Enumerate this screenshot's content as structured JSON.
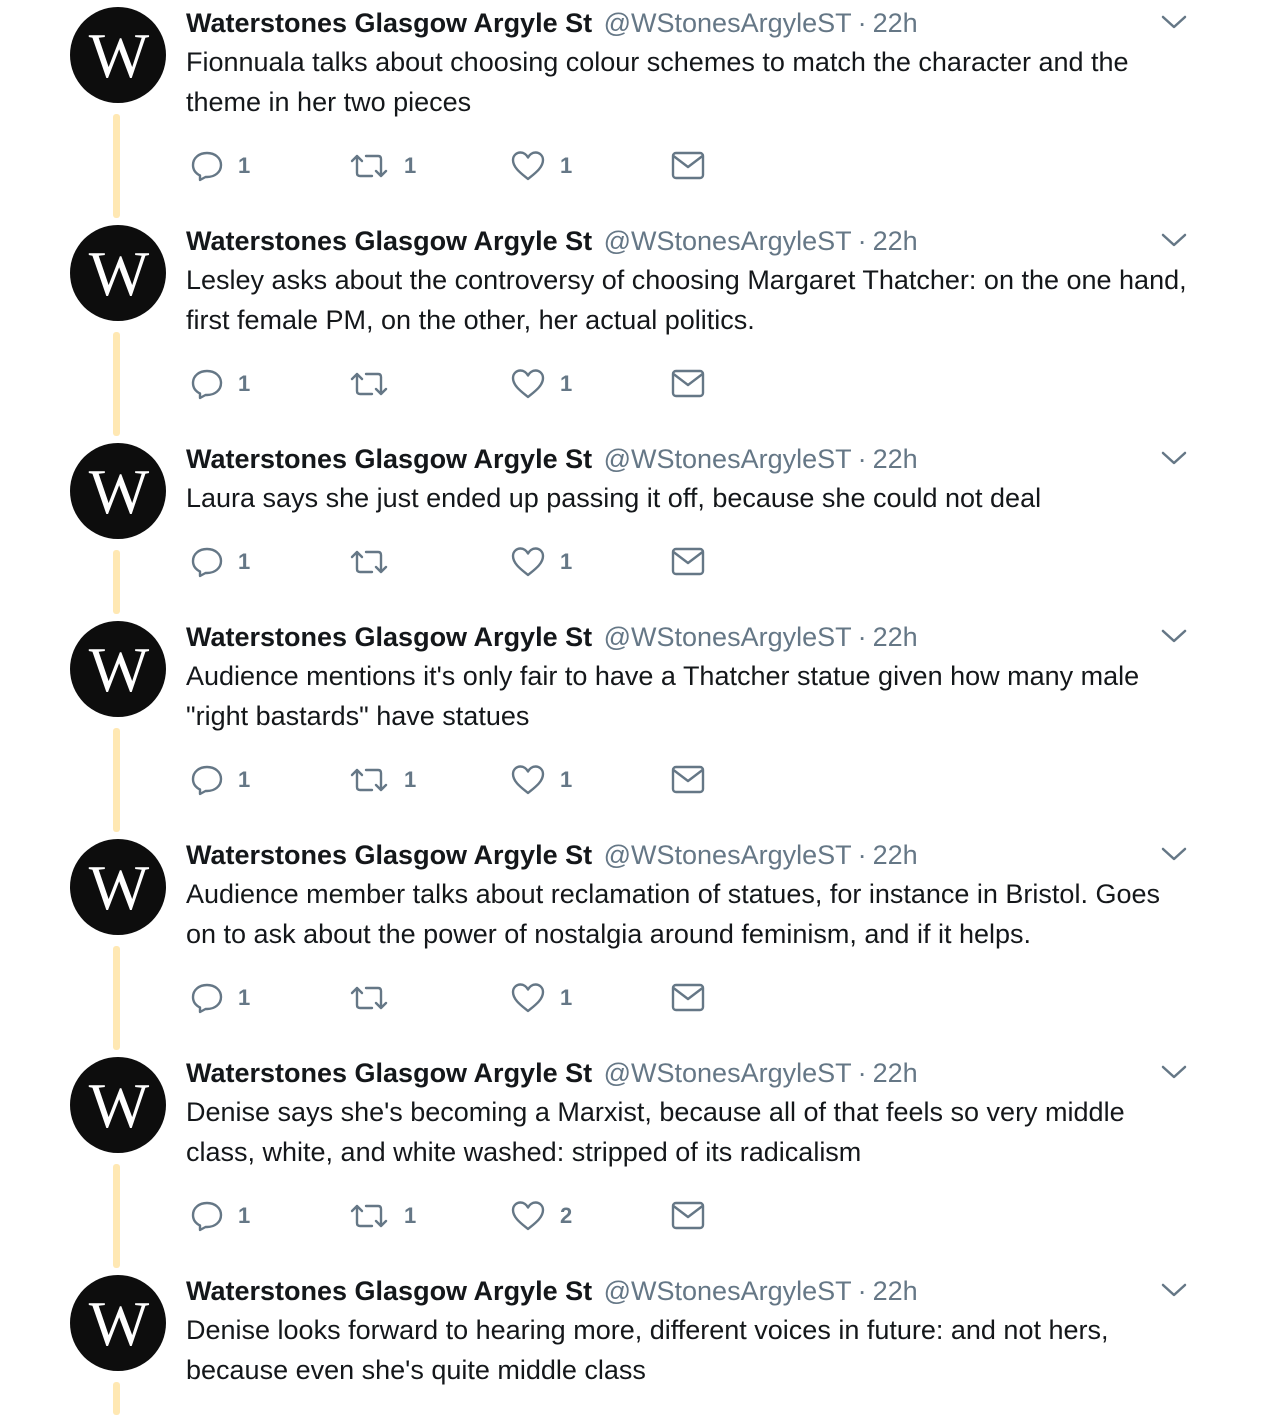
{
  "account": {
    "name": "Waterstones Glasgow Argyle St",
    "handle": "@WStonesArgyleST",
    "separator": "·",
    "avatar_letter": "W"
  },
  "colors": {
    "thread_line": "#ffe8b3",
    "muted": "#657786",
    "text": "#14171a",
    "avatar_bg": "#0d0d0d"
  },
  "icons": {
    "reply": "reply-icon",
    "retweet": "retweet-icon",
    "like": "heart-icon",
    "dm": "envelope-icon",
    "menu": "chevron-down-icon"
  },
  "tweets": [
    {
      "time": "22h",
      "text": "Fionnuala talks about choosing colour schemes to match the character and the theme in her two pieces",
      "replies": "1",
      "retweets": "1",
      "likes": "1"
    },
    {
      "time": "22h",
      "text": "Lesley asks about the controversy of choosing Margaret Thatcher: on the one hand, first female PM, on the other, her actual politics.",
      "replies": "1",
      "retweets": "",
      "likes": "1"
    },
    {
      "time": "22h",
      "text": "Laura says she just ended up passing it off, because she could not deal",
      "replies": "1",
      "retweets": "",
      "likes": "1"
    },
    {
      "time": "22h",
      "text": "Audience mentions it's only fair to have a Thatcher statue given how many male \"right bastards\" have statues",
      "replies": "1",
      "retweets": "1",
      "likes": "1"
    },
    {
      "time": "22h",
      "text": "Audience member talks about reclamation of statues, for instance in Bristol. Goes on to ask about the power of nostalgia around feminism, and if it helps.",
      "replies": "1",
      "retweets": "",
      "likes": "1"
    },
    {
      "time": "22h",
      "text": "Denise says she's becoming a Marxist, because all of that feels so very middle class, white, and white washed: stripped of its radicalism",
      "replies": "1",
      "retweets": "1",
      "likes": "2"
    },
    {
      "time": "22h",
      "text": "Denise looks forward to hearing more, different voices in future: and not hers, because even she's quite middle class"
    }
  ]
}
